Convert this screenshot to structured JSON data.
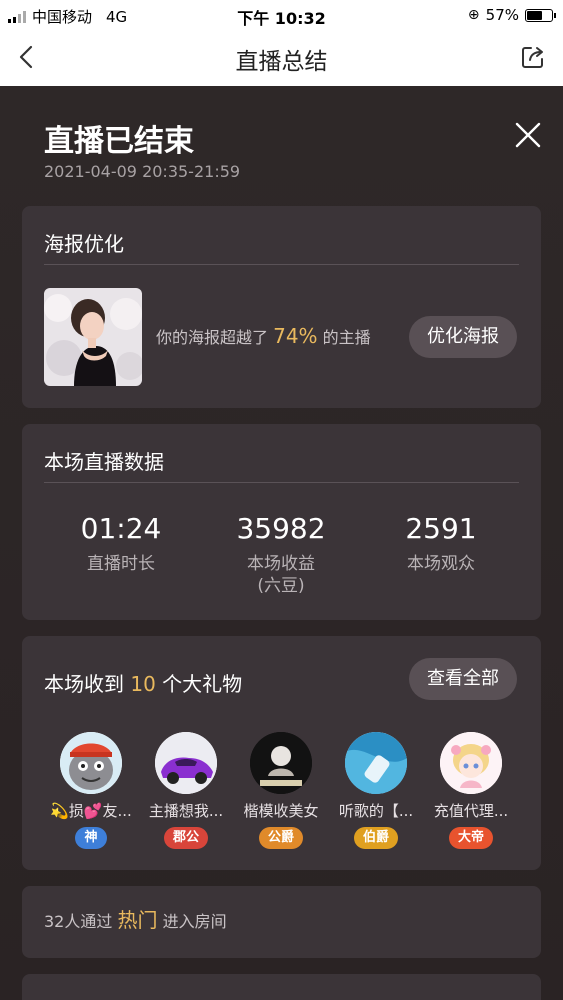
{
  "status_bar": {
    "carrier": "中国移动",
    "network": "4G",
    "time": "下午 10:32",
    "battery": "57%"
  },
  "nav": {
    "title": "直播总结"
  },
  "header": {
    "title": "直播已结束",
    "time_range": "2021-04-09 20:35-21:59"
  },
  "poster_card": {
    "title": "海报优化",
    "text_before": "你的海报超越了",
    "percent": "74%",
    "text_after": "的主播",
    "button": "优化海报"
  },
  "stats_card": {
    "title": "本场直播数据",
    "items": [
      {
        "value": "01:24",
        "label": "直播时长",
        "sublabel": ""
      },
      {
        "value": "35982",
        "label": "本场收益",
        "sublabel": "(六豆)"
      },
      {
        "value": "2591",
        "label": "本场观众",
        "sublabel": ""
      }
    ]
  },
  "gifts_card": {
    "title_before": "本场收到",
    "count": "10",
    "title_after": "个大礼物",
    "button": "查看全部",
    "gifts": [
      {
        "name": "💫损💕友...",
        "badge": "神",
        "color": "#3e7fd9"
      },
      {
        "name": "主播想我...",
        "badge": "郡公",
        "color": "#d8453a"
      },
      {
        "name": "楷模收美女",
        "badge": "公爵",
        "color": "#e08a2a"
      },
      {
        "name": "听歌的【...",
        "badge": "伯爵",
        "color": "#e0a020"
      },
      {
        "name": "充值代理...",
        "badge": "大帝",
        "color": "#e8532e"
      }
    ]
  },
  "hot_card": {
    "text_before": "32人通过",
    "highlight": "热门",
    "text_after": "进入房间"
  }
}
